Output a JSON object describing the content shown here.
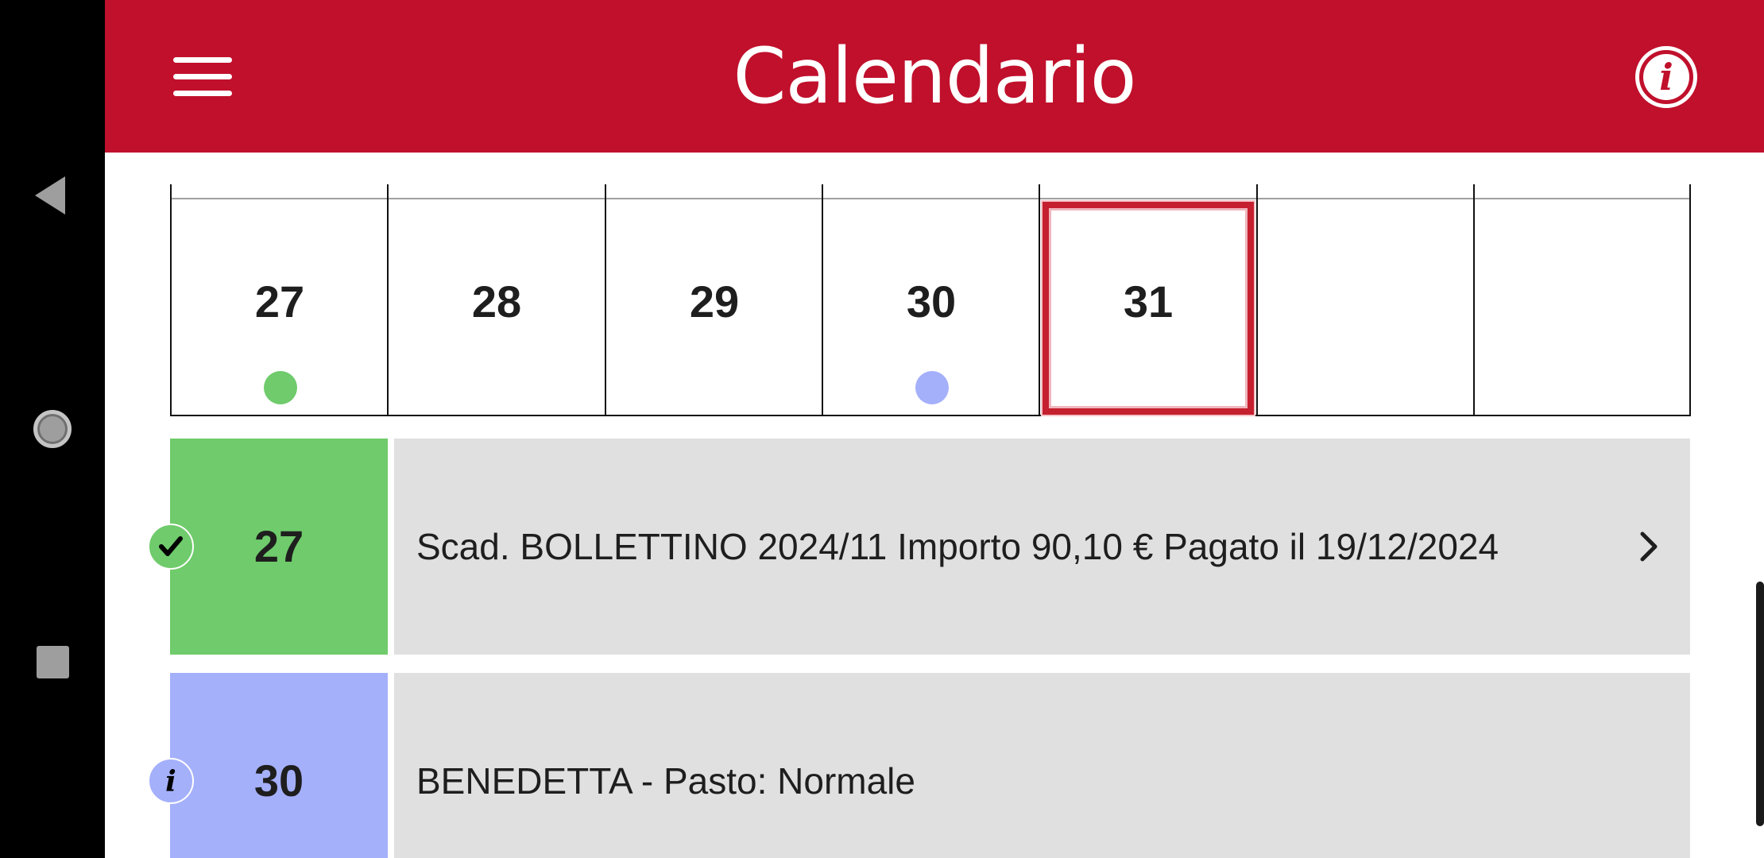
{
  "app": {
    "title": "Calendario"
  },
  "icons": {
    "menu": "menu-icon",
    "info": "info-icon",
    "check": "check-icon",
    "event_info": "info-icon",
    "chevron": "chevron-right-icon"
  },
  "colors": {
    "brand": "#c0102c",
    "paid": "#6fcb6b",
    "info": "#a5b0fb",
    "selected_border": "#c5202f",
    "row_bg": "#e0e0e0"
  },
  "week": {
    "days": [
      {
        "label": "27",
        "dot": "paid"
      },
      {
        "label": "28",
        "dot": ""
      },
      {
        "label": "29",
        "dot": ""
      },
      {
        "label": "30",
        "dot": "info"
      },
      {
        "label": "31",
        "dot": "",
        "selected": true
      },
      {
        "label": "",
        "dot": ""
      },
      {
        "label": "",
        "dot": ""
      }
    ]
  },
  "events": [
    {
      "day": "27",
      "type": "paid",
      "badge": "check-icon",
      "text": "Scad. BOLLETTINO 2024/11 Importo 90,10 € Pagato il 19/12/2024",
      "has_chevron": true
    },
    {
      "day": "30",
      "type": "info",
      "badge": "info-icon",
      "text": "BENEDETTA - Pasto: Normale",
      "has_chevron": false
    }
  ]
}
